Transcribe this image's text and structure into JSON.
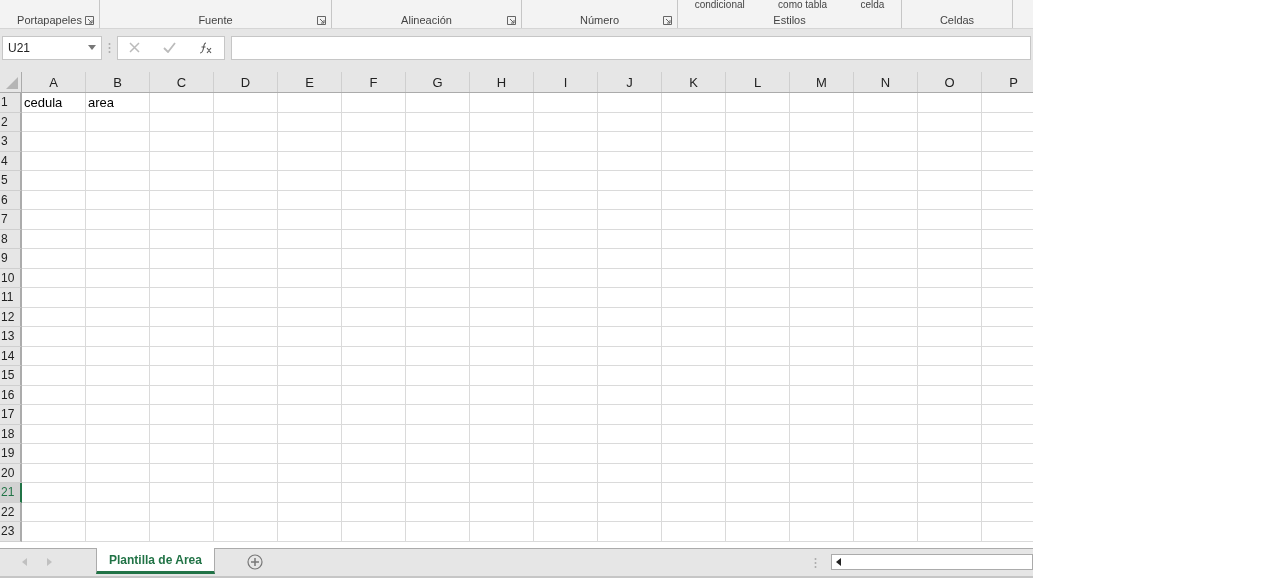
{
  "ribbon": {
    "groups": [
      {
        "label": "Portapapeles",
        "launcher": true
      },
      {
        "label": "Fuente",
        "launcher": true
      },
      {
        "label": "Alineación",
        "launcher": true
      },
      {
        "label": "Número",
        "launcher": true
      },
      {
        "label": "Estilos",
        "launcher": false,
        "buttons": [
          "condicional",
          "como tabla",
          "celda"
        ]
      },
      {
        "label": "Celdas",
        "launcher": false
      }
    ]
  },
  "formula_bar": {
    "name_box": "U21"
  },
  "grid": {
    "columns": [
      "A",
      "B",
      "C",
      "D",
      "E",
      "F",
      "G",
      "H",
      "I",
      "J",
      "K",
      "L",
      "M",
      "N",
      "O",
      "P"
    ],
    "rows": [
      {
        "label": "1",
        "selected": false,
        "cells": [
          "cedula",
          "area"
        ]
      },
      {
        "label": "2",
        "selected": false
      },
      {
        "label": "3",
        "selected": false
      },
      {
        "label": "4",
        "selected": false
      },
      {
        "label": "5",
        "selected": false
      },
      {
        "label": "6",
        "selected": false
      },
      {
        "label": "7",
        "selected": false
      },
      {
        "label": "8",
        "selected": false
      },
      {
        "label": "9",
        "selected": false
      },
      {
        "label": "10",
        "selected": false
      },
      {
        "label": "11",
        "selected": false
      },
      {
        "label": "12",
        "selected": false
      },
      {
        "label": "13",
        "selected": false
      },
      {
        "label": "14",
        "selected": false
      },
      {
        "label": "15",
        "selected": false
      },
      {
        "label": "16",
        "selected": false
      },
      {
        "label": "17",
        "selected": false
      },
      {
        "label": "18",
        "selected": false
      },
      {
        "label": "19",
        "selected": false
      },
      {
        "label": "20",
        "selected": false
      },
      {
        "label": "21",
        "selected": true
      },
      {
        "label": "22",
        "selected": false
      },
      {
        "label": "23",
        "selected": false
      }
    ]
  },
  "sheet_tabs": [
    {
      "label": "Plantilla de Area",
      "selected": true
    }
  ]
}
